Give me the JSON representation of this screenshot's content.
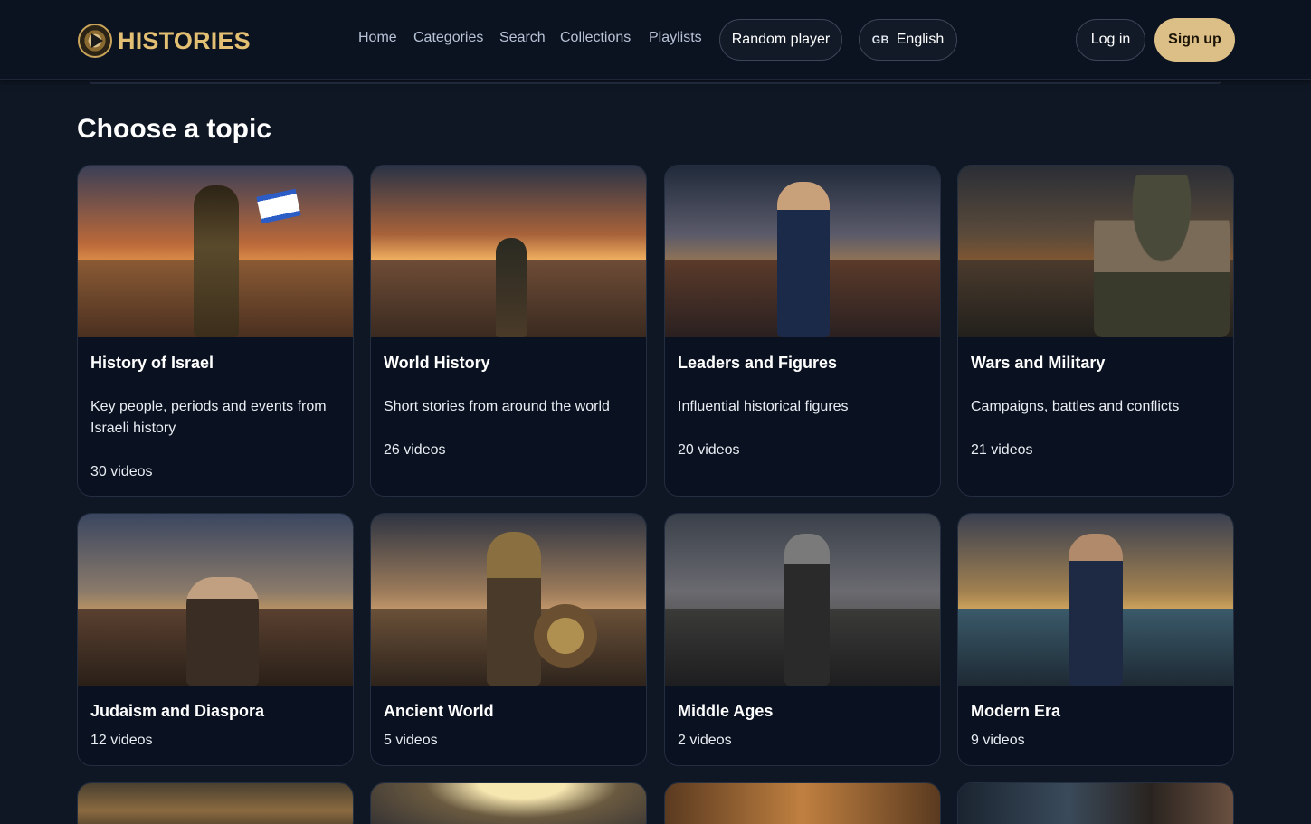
{
  "brand": {
    "name": "HISTORIES",
    "icon": "play-logo-icon"
  },
  "nav": {
    "links": [
      "Home",
      "Categories",
      "Search",
      "Collections",
      "Playlists"
    ],
    "random_player": "Random player",
    "language_code": "GB",
    "language": "English",
    "login": "Log in",
    "signup": "Sign up"
  },
  "main": {
    "title": "Choose a topic",
    "categories": [
      {
        "title": "History of Israel",
        "description": "Key people, periods and events from Israeli history",
        "count": "30 videos"
      },
      {
        "title": "World History",
        "description": "Short stories from around the world",
        "count": "26 videos"
      },
      {
        "title": "Leaders and Figures",
        "description": "Influential historical figures",
        "count": "20 videos"
      },
      {
        "title": "Wars and Military",
        "description": "Campaigns, battles and conflicts",
        "count": "21 videos"
      },
      {
        "title": "Judaism and Diaspora",
        "count": "12 videos"
      },
      {
        "title": "Ancient World",
        "count": "5 videos"
      },
      {
        "title": "Middle Ages",
        "count": "2 videos"
      },
      {
        "title": "Modern Era",
        "count": "9 videos"
      }
    ]
  },
  "colors": {
    "accent": "#dcbf86",
    "background": "#0f1724",
    "card": "#0a1120"
  }
}
